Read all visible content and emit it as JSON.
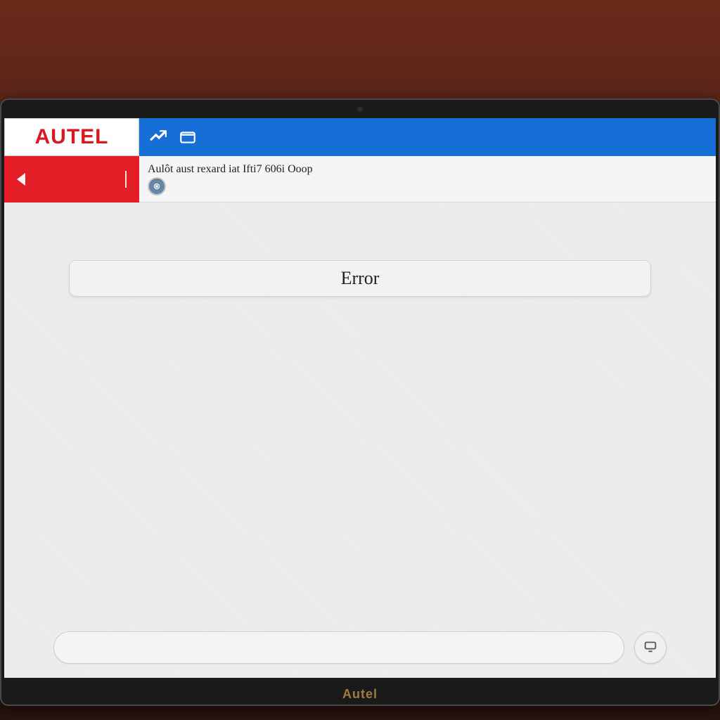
{
  "brand": {
    "logo_text": "AUTEL",
    "device_label": "Autel"
  },
  "toolbar": {
    "icons": {
      "tool": "tool-icon",
      "folder": "folder-icon"
    }
  },
  "sidebar": {
    "back_label": ""
  },
  "breadcrumb": {
    "text": "Aulôt aust rexard iat Ifti7 606i Ooop",
    "action_icon": "target-icon"
  },
  "main": {
    "status_label": "Error",
    "input_value": "",
    "input_placeholder": ""
  }
}
